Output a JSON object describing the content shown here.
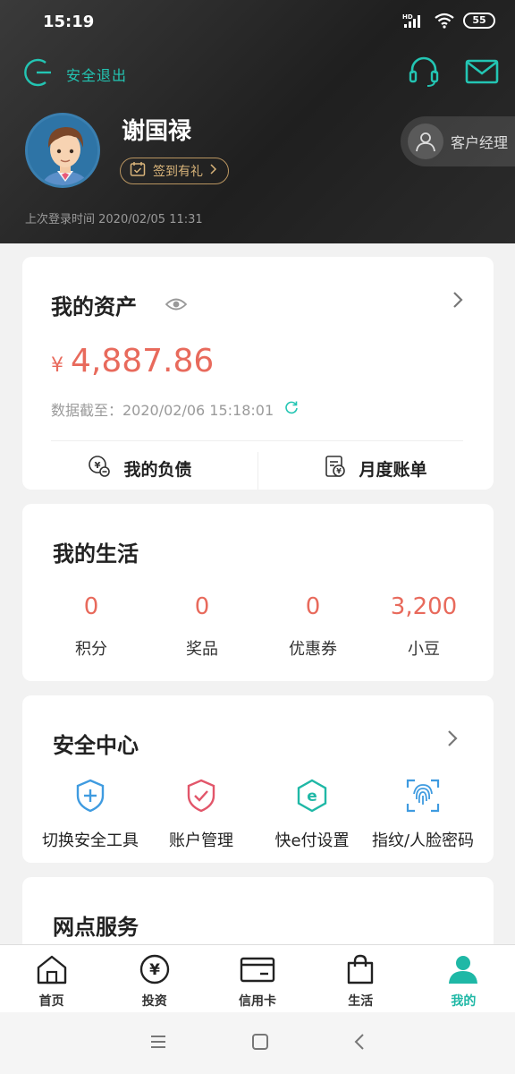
{
  "status_bar": {
    "time": "15:19",
    "network": "HD",
    "battery": "55"
  },
  "header": {
    "logout_label": "安全退出",
    "user_name": "谢国禄",
    "signin_label": "签到有礼",
    "last_login": "上次登录时间 2020/02/05 11:31",
    "manager_label": "客户经理"
  },
  "assets": {
    "title": "我的资产",
    "currency": "¥",
    "amount": "4,887.86",
    "updated": "数据截至：2020/02/06 15:18:01",
    "actions": [
      {
        "label": "我的负债",
        "icon": "debt-icon"
      },
      {
        "label": "月度账单",
        "icon": "bill-icon"
      }
    ]
  },
  "life": {
    "title": "我的生活",
    "stats": [
      {
        "value": "0",
        "label": "积分"
      },
      {
        "value": "0",
        "label": "奖品"
      },
      {
        "value": "0",
        "label": "优惠券"
      },
      {
        "value": "3,200",
        "label": "小豆"
      }
    ]
  },
  "security": {
    "title": "安全中心",
    "items": [
      {
        "label": "切换安全工具",
        "icon": "shield-plus-icon"
      },
      {
        "label": "账户管理",
        "icon": "shield-check-icon"
      },
      {
        "label": "快e付设置",
        "icon": "e-pay-icon"
      },
      {
        "label": "指纹/人脸密码",
        "icon": "fingerprint-icon"
      }
    ]
  },
  "outlet": {
    "title": "网点服务"
  },
  "tabs": [
    {
      "label": "首页",
      "icon": "home-icon"
    },
    {
      "label": "投资",
      "icon": "yen-coin-icon"
    },
    {
      "label": "信用卡",
      "icon": "credit-card-icon"
    },
    {
      "label": "生活",
      "icon": "shopping-bag-icon"
    },
    {
      "label": "我的",
      "icon": "person-icon"
    }
  ],
  "colors": {
    "accent": "#1fb8a6",
    "amount": "#e86a5c",
    "gold": "#d9b47a"
  }
}
